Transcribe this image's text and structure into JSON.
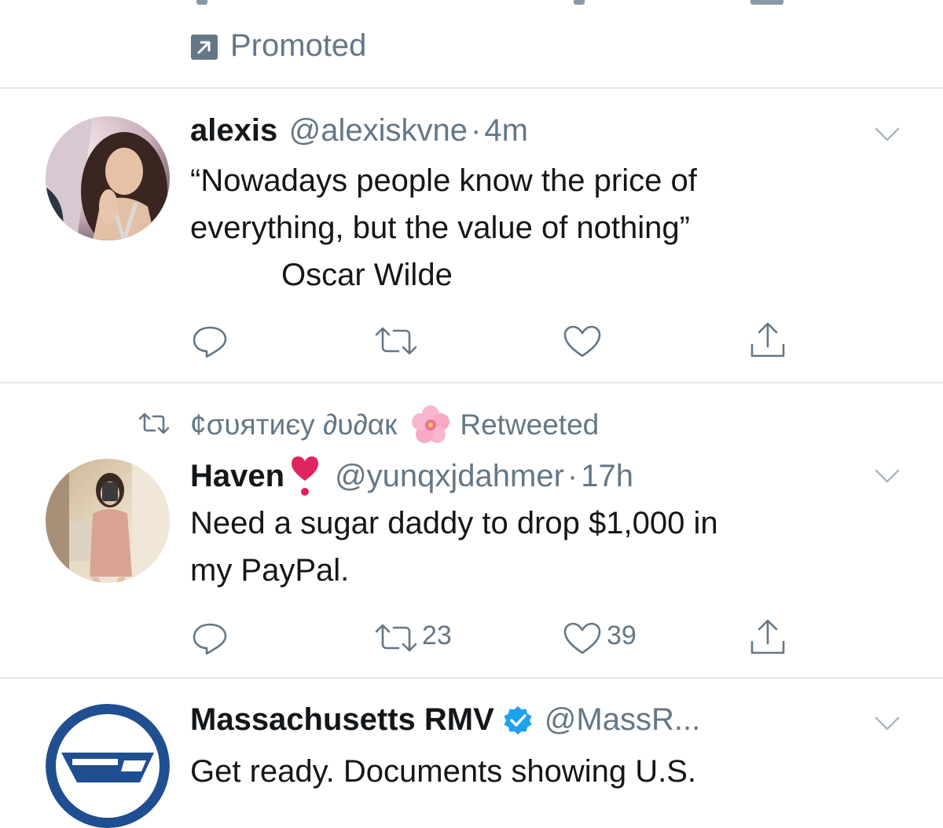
{
  "promoted": {
    "label": "Promoted"
  },
  "tweets": [
    {
      "name": "alexis",
      "handle": "@alexiskvne",
      "separator": "·",
      "time": "4m",
      "text_lines": [
        "“Nowadays people know the price of",
        "everything, but the value of nothing”",
        "Oscar Wilde"
      ],
      "actions": {
        "reply_count": "",
        "retweet_count": "",
        "like_count": ""
      }
    },
    {
      "retweeted_by": "¢συятиєу ∂υ∂αк",
      "retweeted_label": "Retweeted",
      "name": "Haven",
      "name_emoji": "❣️",
      "handle": "@yunqxjdahmer",
      "separator": "·",
      "time": "17h",
      "text_lines": [
        "Need a sugar daddy to drop $1,000 in",
        "my PayPal."
      ],
      "actions": {
        "reply_count": "",
        "retweet_count": "23",
        "like_count": "39"
      }
    },
    {
      "name": "Massachusetts RMV",
      "verified": true,
      "handle": "@MassR...",
      "text_partial": "Get ready. Documents showing U.S."
    }
  ],
  "colors": {
    "muted": "#657786",
    "divider": "#e1e8ed",
    "verified": "#1da1f2",
    "rmv_blue": "#1f4e91",
    "emoji_red": "#e0245e"
  },
  "icons": [
    "promoted-icon",
    "chevron-down-icon",
    "reply-icon",
    "retweet-icon",
    "like-icon",
    "share-icon",
    "verified-badge-icon",
    "cherry-blossom-icon"
  ]
}
